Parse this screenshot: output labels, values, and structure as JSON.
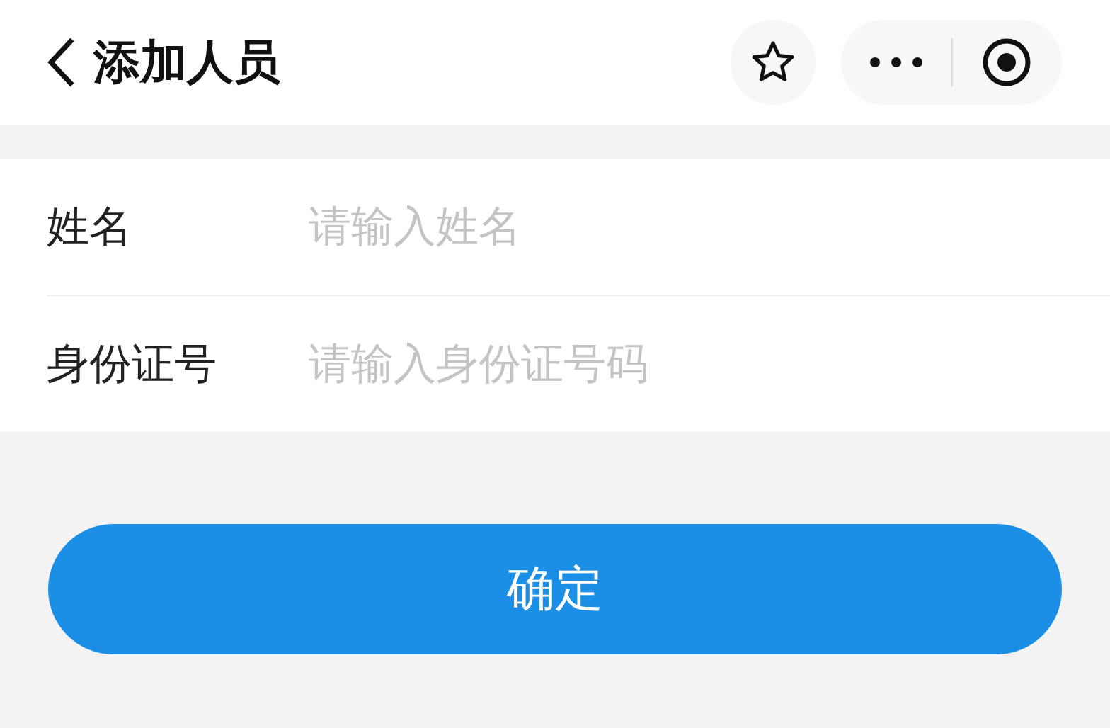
{
  "header": {
    "title": "添加人员"
  },
  "form": {
    "fields": [
      {
        "label": "姓名",
        "placeholder": "请输入姓名"
      },
      {
        "label": "身份证号",
        "placeholder": "请输入身份证号码"
      }
    ]
  },
  "confirm_button": {
    "label": "确定"
  }
}
